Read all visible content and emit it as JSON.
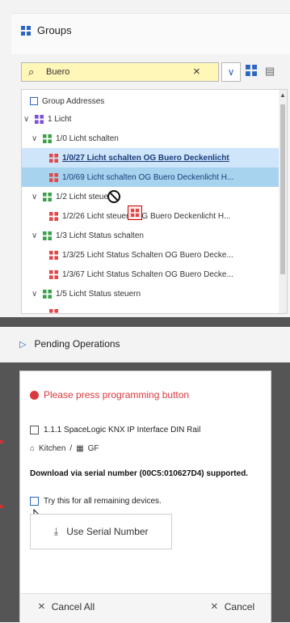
{
  "groups": {
    "title": "Groups",
    "search": {
      "value": "Buero",
      "clear_icon": "close-icon",
      "dropdown_icon": "chevron-down-icon"
    },
    "tree": {
      "root": "Group Addresses",
      "rows": [
        {
          "label": "1 Licht",
          "kind": "main"
        },
        {
          "label": "1/0 Licht schalten",
          "kind": "middle"
        },
        {
          "label": "1/0/27 Licht schalten OG Buero Deckenlicht",
          "kind": "ga"
        },
        {
          "label": "1/0/69 Licht schalten OG Buero Deckenlicht H...",
          "kind": "ga"
        },
        {
          "label": "1/2 Licht steuern",
          "kind": "middle"
        },
        {
          "label": "1/2/26 Licht steuern OG Buero Deckenlicht H...",
          "kind": "ga"
        },
        {
          "label": "1/3 Licht Status schalten",
          "kind": "middle"
        },
        {
          "label": "1/3/25 Licht Status Schalten OG Buero Decke...",
          "kind": "ga"
        },
        {
          "label": "1/3/67 Licht Status Schalten OG Buero Decke...",
          "kind": "ga"
        },
        {
          "label": "1/5 Licht Status steuern",
          "kind": "middle"
        }
      ]
    },
    "colors": {
      "main": "#7b4fd6",
      "middle": "#3aa04a",
      "ga": "#e04848",
      "accent": "#2b66c2"
    }
  },
  "pending": {
    "title": "Pending Operations",
    "prompt": "Please press programming button",
    "device": "1.1.1 SpaceLogic KNX IP Interface DIN Rail",
    "room": "Kitchen",
    "floor": "GF",
    "download_text": "Download via serial number (00C5:010627D4) supported.",
    "checkbox_label": "Try this for all remaining devices.",
    "use_serial_label": "Use Serial Number",
    "cancel_all_label": "Cancel All",
    "cancel_label": "Cancel"
  }
}
